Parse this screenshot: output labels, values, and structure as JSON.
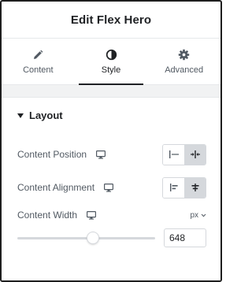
{
  "header": {
    "title": "Edit Flex Hero"
  },
  "tabs": [
    {
      "label": "Content",
      "icon": "pencil-icon",
      "active": false
    },
    {
      "label": "Style",
      "icon": "contrast-icon",
      "active": true
    },
    {
      "label": "Advanced",
      "icon": "gear-icon",
      "active": false
    }
  ],
  "section": {
    "title": "Layout",
    "expanded": true
  },
  "controls": {
    "content_position": {
      "label": "Content Position",
      "device_icon": "desktop-icon",
      "selected": "center"
    },
    "content_alignment": {
      "label": "Content Alignment",
      "device_icon": "desktop-icon",
      "selected": "center"
    },
    "content_width": {
      "label": "Content Width",
      "device_icon": "desktop-icon",
      "unit": "px",
      "value": "648",
      "slider_fraction": 0.55
    }
  },
  "colors": {
    "active_tab": "#1f2124",
    "button_active_bg": "#d5d8dc",
    "panel_band": "#f1f2f3"
  }
}
